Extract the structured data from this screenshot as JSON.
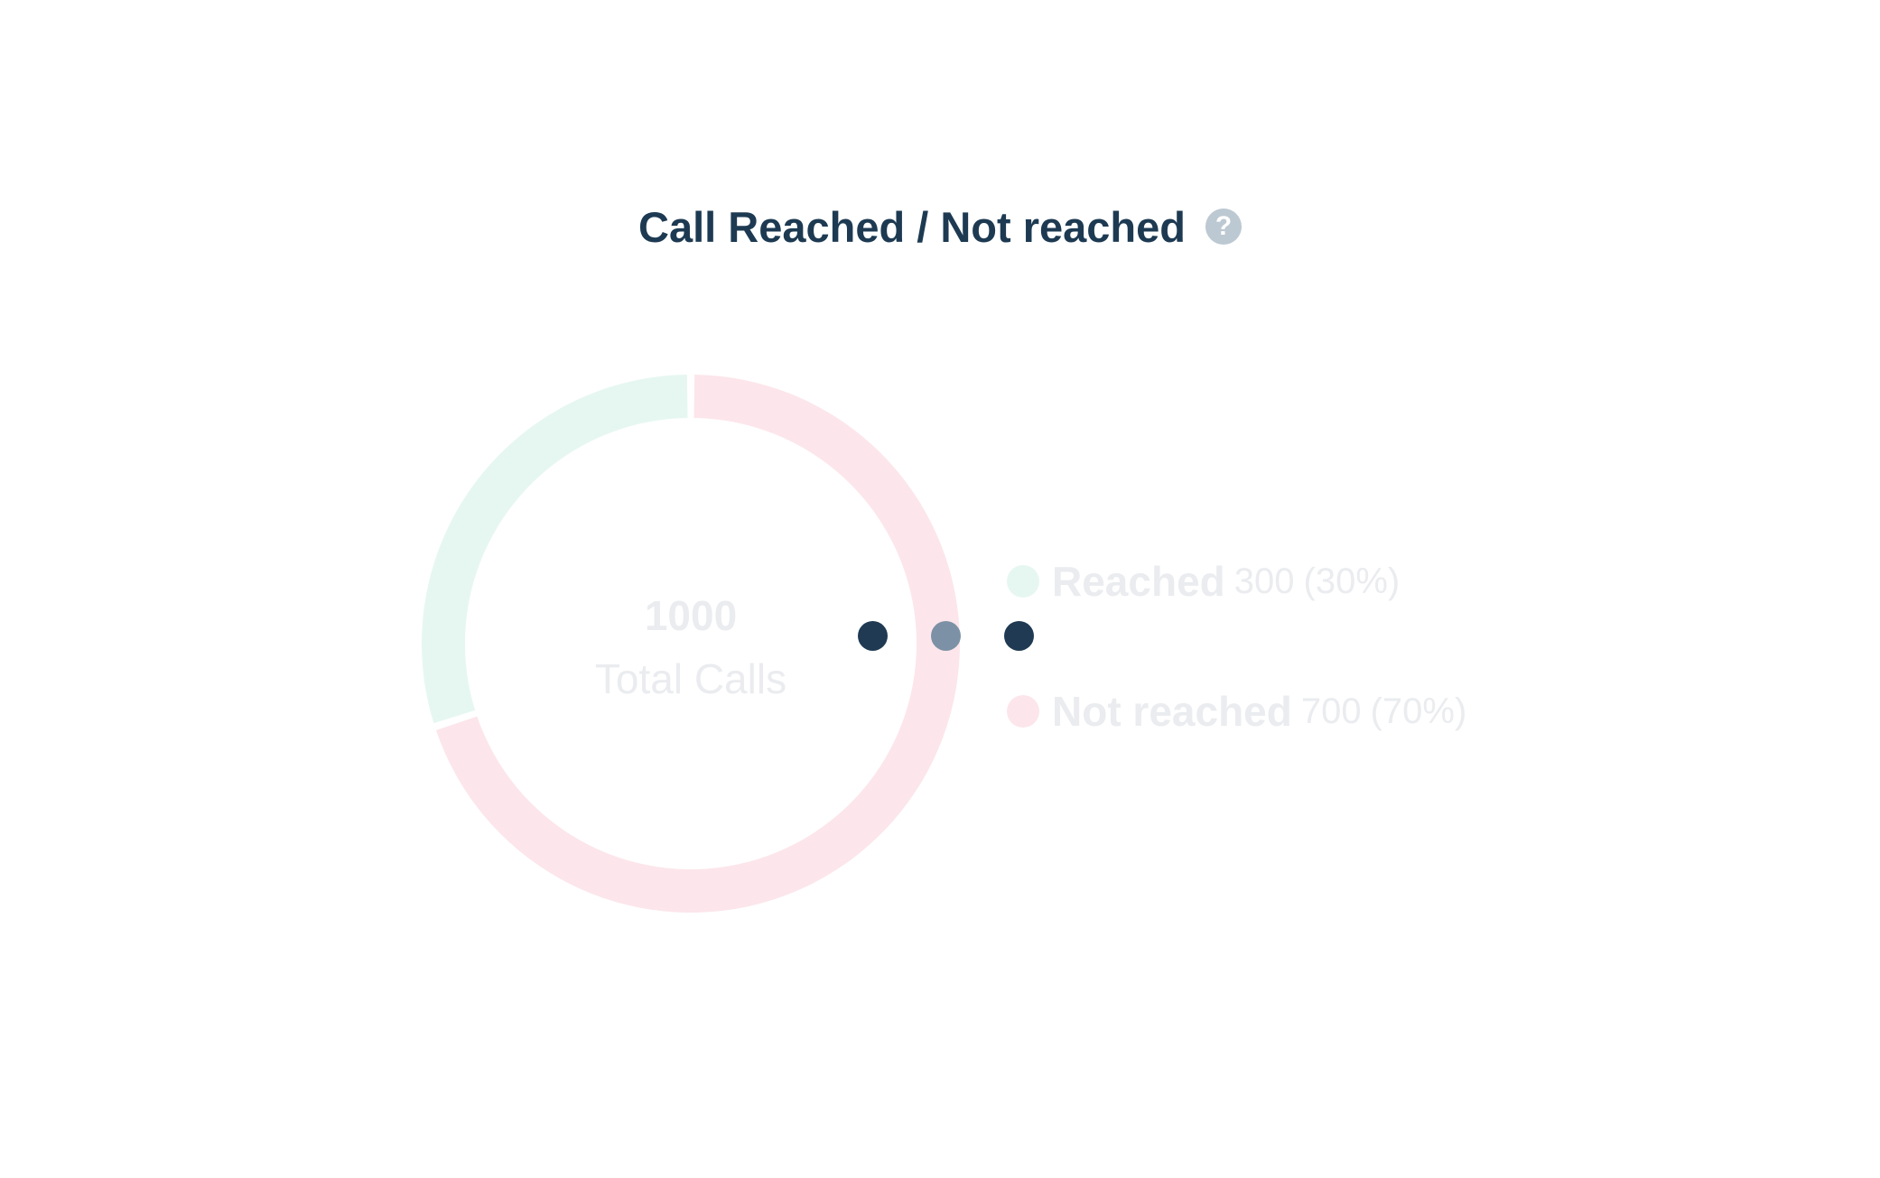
{
  "header": {
    "title": "Call Reached / Not reached",
    "help_icon": "question-mark-icon",
    "help_glyph": "?"
  },
  "chart_data": {
    "type": "pie",
    "variant": "donut",
    "title": "Call Reached / Not reached",
    "center_total": "1000",
    "center_label": "Total Calls",
    "slices": [
      {
        "name": "Reached",
        "value": 300,
        "percent": 30,
        "color": "#e6f7f1",
        "value_label": "300",
        "percent_label": "(30%)"
      },
      {
        "name": "Not reached",
        "value": 700,
        "percent": 70,
        "color": "#fce6eb",
        "value_label": "700",
        "percent_label": "(70%)"
      }
    ],
    "legend_position": "right"
  },
  "loading_indicator": {
    "icon": "loading-dots-icon",
    "dot_colors": [
      "#1f3a52",
      "#7d91a6",
      "#1f3a52"
    ]
  },
  "colors": {
    "title": "#1d3a52",
    "help_icon_bg": "#bcc8d2",
    "faded_text": "#eaecef"
  }
}
